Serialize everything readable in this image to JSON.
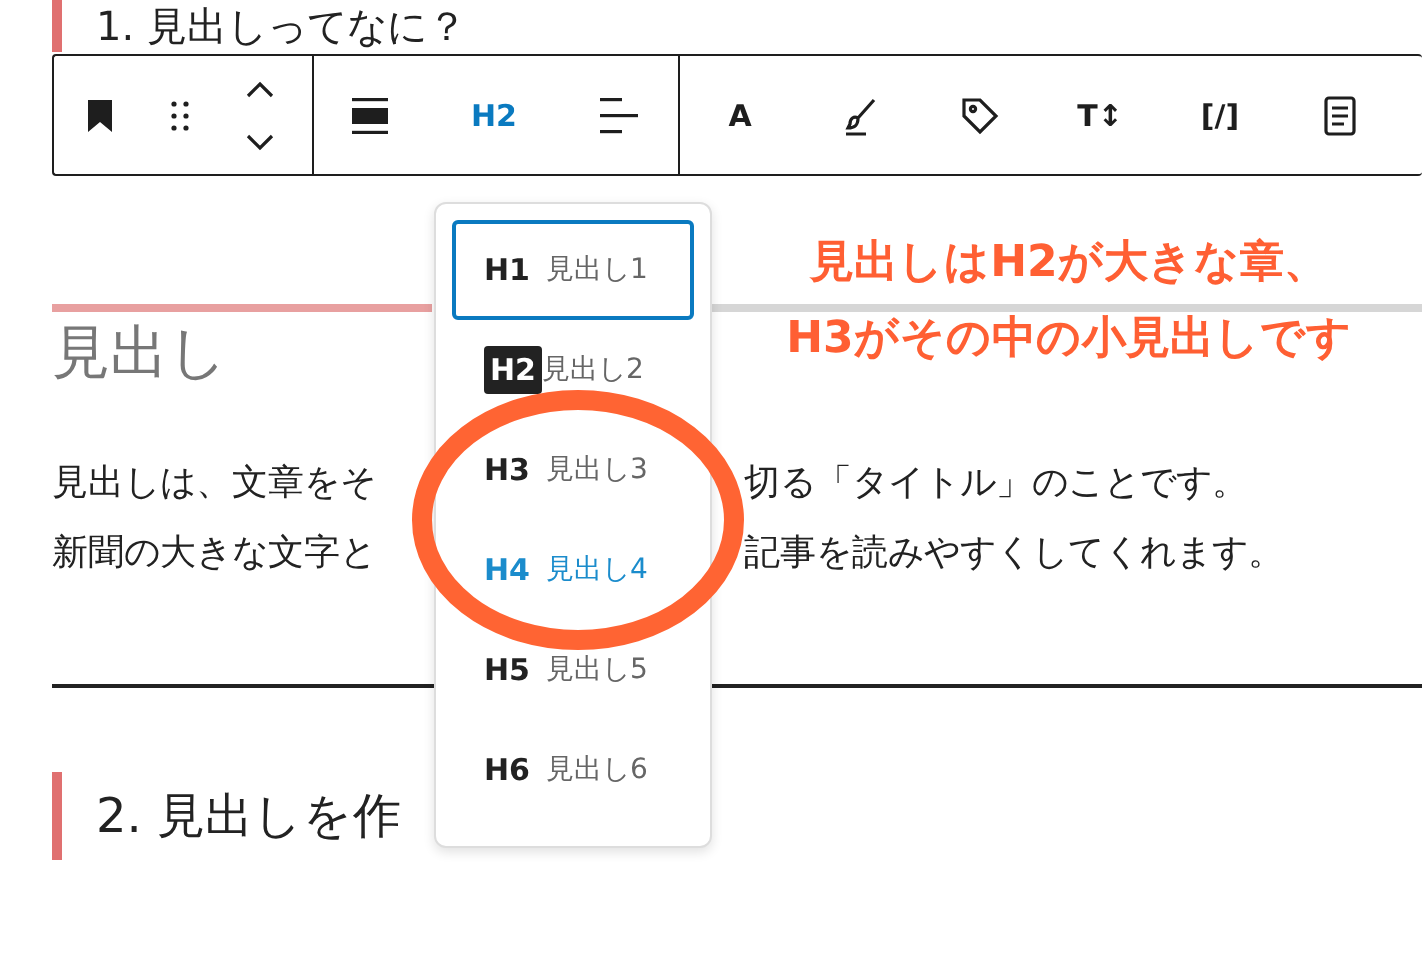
{
  "article": {
    "heading_1": "1. 見出しってなに？",
    "block_heading": "見出し",
    "paragraph_lines": [
      {
        "left": "見出しは、文章をそ",
        "right": "切る「タイトル」のことです。"
      },
      {
        "left": "新聞の大きな文字と",
        "right": "記事を読みやすくしてくれます。"
      }
    ],
    "heading_2": "2. 見出しを作"
  },
  "toolbar": {
    "level_button": {
      "label": "H2",
      "active": true
    },
    "format_buttons": [
      "A",
      "T↕",
      "[/]"
    ]
  },
  "heading_menu": [
    {
      "level": "H1",
      "label": "見出し1",
      "selected": true,
      "hovered": false,
      "kind": "plain"
    },
    {
      "level": "H2",
      "label": "見出し2",
      "selected": false,
      "hovered": false,
      "kind": "badge"
    },
    {
      "level": "H3",
      "label": "見出し3",
      "selected": false,
      "hovered": false,
      "kind": "plain"
    },
    {
      "level": "H4",
      "label": "見出し4",
      "selected": false,
      "hovered": true,
      "kind": "plain"
    },
    {
      "level": "H5",
      "label": "見出し5",
      "selected": false,
      "hovered": false,
      "kind": "plain"
    },
    {
      "level": "H6",
      "label": "見出し6",
      "selected": false,
      "hovered": false,
      "kind": "plain"
    }
  ],
  "annotation": {
    "lines": [
      "見出しはH2が大きな章、",
      "H3がその中の小見出しです"
    ]
  }
}
